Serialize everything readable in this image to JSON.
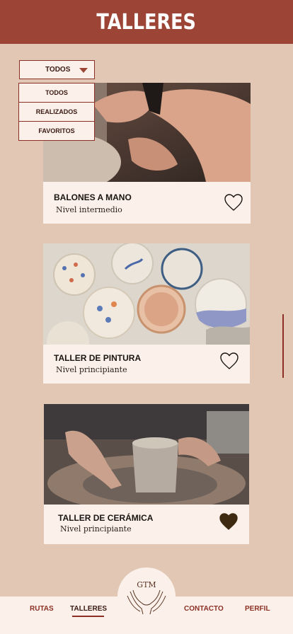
{
  "header": {
    "title": "TALLERES"
  },
  "filter": {
    "selected": "TODOS",
    "options": [
      "TODOS",
      "REALIZADOS",
      "FAVORITOS"
    ]
  },
  "cards": [
    {
      "title": "BALONES A MANO",
      "level": "Nivel intermedio",
      "favorite": false,
      "photo": "hands-clay-photo"
    },
    {
      "title": "TALLER DE PINTURA",
      "level": "Nivel principiante",
      "favorite": false,
      "photo": "painted-plates-photo"
    },
    {
      "title": "TALLER DE CERÁMICA",
      "level": "Nivel principiante",
      "favorite": true,
      "photo": "pottery-wheel-photo"
    }
  ],
  "nav": {
    "items": [
      "RUTAS",
      "TALLERES",
      "CONTACTO",
      "PERFIL"
    ],
    "active": "TALLERES",
    "logo_text": "GTM"
  },
  "colors": {
    "header": "#9c4537",
    "background": "#e2c8b4",
    "card": "#fbf1ea",
    "accent": "#8c2f25",
    "heart_filled": "#3d2a10"
  }
}
